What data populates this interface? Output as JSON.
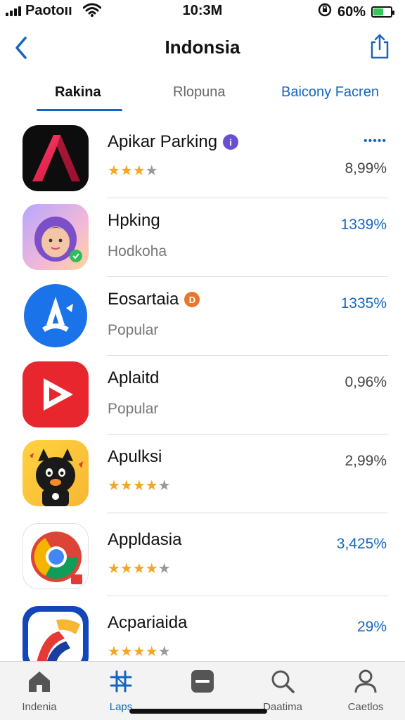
{
  "status_bar": {
    "carrier": "Paotoıı",
    "time": "10:3M",
    "battery": "60%",
    "battery_level": 0.6
  },
  "header": {
    "title": "Indonsia",
    "back_icon": "chevron-left-icon",
    "share_icon": "share-icon"
  },
  "tabs": [
    {
      "label": "Rakina",
      "active": true
    },
    {
      "label": "Rlopuna",
      "active": false
    },
    {
      "label": "Baicony Facren",
      "active": false
    }
  ],
  "apps": [
    {
      "name": "Apikar Parking",
      "badge_color": "#6b4fd1",
      "rating": 3,
      "value_top": "•••••",
      "value": "8,99%"
    },
    {
      "name": "Hpking",
      "subtitle": "Hodkoha",
      "value": "1339%"
    },
    {
      "name": "Eosartaia",
      "badge_color": "#e8772e",
      "subtitle": "Popular",
      "value": "1335%"
    },
    {
      "name": "Aplaitd",
      "subtitle": "Popular",
      "value": "0,96%"
    },
    {
      "name": "Apulksi",
      "rating": 4,
      "value": "2,99%"
    },
    {
      "name": "Appldasia",
      "rating": 4,
      "value": "3,425%"
    },
    {
      "name": "Acpariaida",
      "rating": 4,
      "value": "29%"
    }
  ],
  "tabbar": [
    {
      "label": "Indenia",
      "icon": "home-icon"
    },
    {
      "label": "Laps",
      "icon": "apps-icon",
      "active": true
    },
    {
      "label": "",
      "icon": "minus-square-icon"
    },
    {
      "label": "Daatima",
      "icon": "search-icon"
    },
    {
      "label": "Caetlos",
      "icon": "person-icon"
    }
  ],
  "colors": {
    "accent": "#1565c0",
    "star": "#f5a623",
    "battery": "#34c759"
  }
}
